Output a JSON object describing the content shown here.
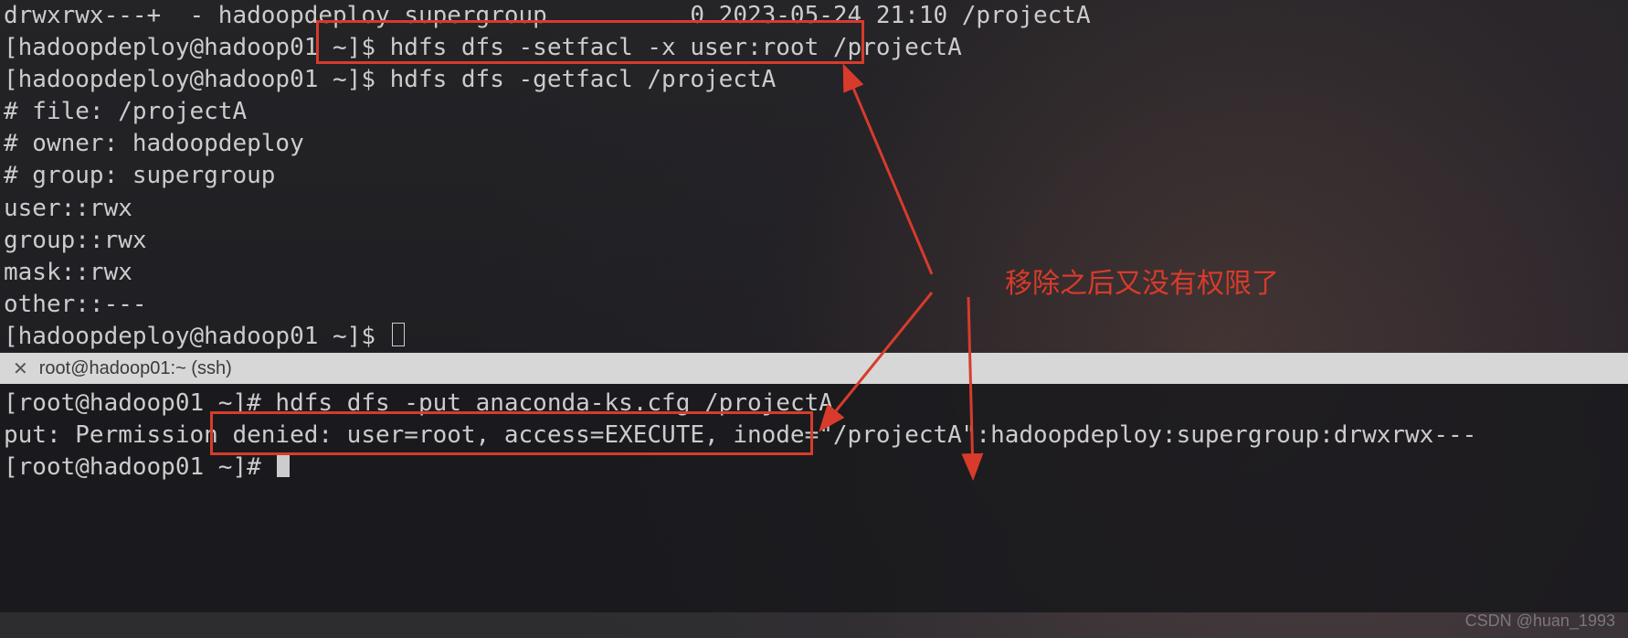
{
  "top": {
    "ls_line": "drwxrwx---+  - hadoopdeploy supergroup          0 2023-05-24 21:10 /projectA",
    "prompt1": "[hadoopdeploy@hadoop01 ~]$ ",
    "cmd_setfacl": "hdfs dfs -setfacl -x user:root /projectA",
    "prompt2": "[hadoopdeploy@hadoop01 ~]$ ",
    "cmd_getfacl": "hdfs dfs -getfacl /projectA",
    "getfacl_out": [
      "# file: /projectA",
      "# owner: hadoopdeploy",
      "# group: supergroup",
      "user::rwx",
      "group::rwx",
      "mask::rwx",
      "other::---",
      ""
    ],
    "prompt3": "[hadoopdeploy@hadoop01 ~]$ "
  },
  "tab": {
    "close_glyph": "✕",
    "title": "root@hadoop01:~ (ssh)"
  },
  "bottom": {
    "prompt1": "[root@hadoop01 ~]# ",
    "cmd_put": "hdfs dfs -put anaconda-ks.cfg /projectA",
    "put_error": "put: Permission denied: user=root, access=EXECUTE, inode=\"/projectA\":hadoopdeploy:supergroup:drwxrwx---",
    "prompt2": "[root@hadoop01 ~]# "
  },
  "annotation": {
    "text": "移除之后又没有权限了"
  },
  "watermark": "CSDN @huan_1993",
  "colors": {
    "highlight": "#d83b2b"
  }
}
